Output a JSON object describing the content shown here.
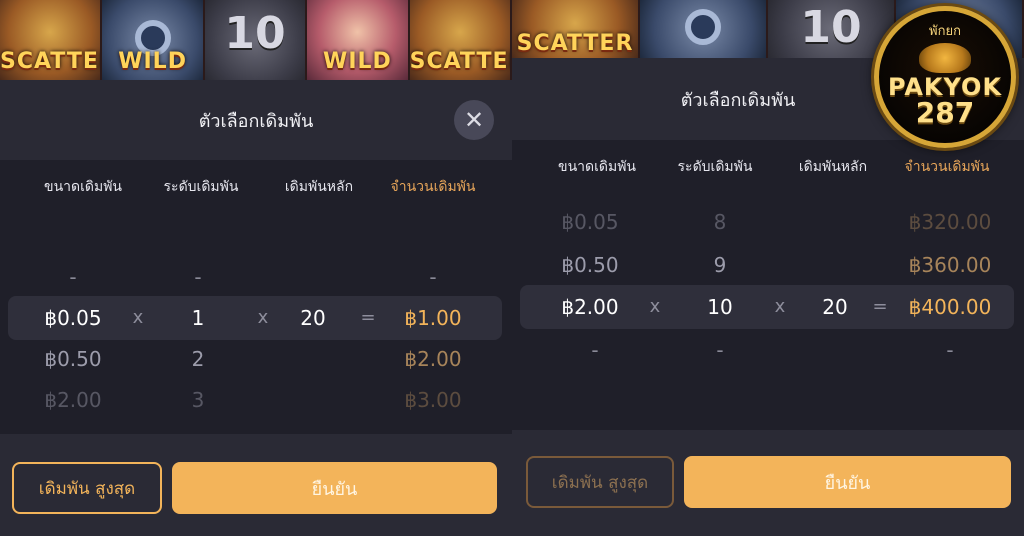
{
  "left": {
    "tiles": [
      {
        "kind": "scatter",
        "text": "SCATTER"
      },
      {
        "kind": "wild",
        "text": "WILD"
      },
      {
        "kind": "ten",
        "text": "10"
      },
      {
        "kind": "queen",
        "text": "WILD"
      },
      {
        "kind": "scatter",
        "text": "SCATTER"
      }
    ],
    "title": "ตัวเลือกเดิมพัน",
    "close_glyph": "✕",
    "columns": [
      "ขนาดเดิมพัน",
      "ระดับเดิมพัน",
      "เดิมพันหลัก",
      "จำนวนเดิมพัน"
    ],
    "rows": [
      {
        "size": "-",
        "level": "-",
        "amount": "-"
      },
      {
        "size": "฿0.05",
        "x1": "x",
        "level": "1",
        "x2": "x",
        "base": "20",
        "eq": "=",
        "amount": "฿1.00"
      },
      {
        "size": "฿0.50",
        "level": "2",
        "amount": "฿2.00"
      },
      {
        "size": "฿2.00",
        "level": "3",
        "amount": "฿3.00"
      }
    ],
    "max_bet_label": "เดิมพัน สูงสุด",
    "confirm_label": "ยืนยัน"
  },
  "right": {
    "tiles": [
      {
        "kind": "scatter",
        "text": "SCATTER"
      },
      {
        "kind": "wild",
        "text": ""
      },
      {
        "kind": "ten",
        "text": "10"
      },
      {
        "kind": "wild",
        "text": ""
      }
    ],
    "title": "ตัวเลือกเดิมพัน",
    "columns": [
      "ขนาดเดิมพัน",
      "ระดับเดิมพัน",
      "เดิมพันหลัก",
      "จำนวนเดิมพัน"
    ],
    "rows": [
      {
        "size": "฿0.05",
        "level": "8",
        "amount": "฿320.00"
      },
      {
        "size": "฿0.50",
        "level": "9",
        "amount": "฿360.00"
      },
      {
        "size": "฿2.00",
        "x1": "x",
        "level": "10",
        "x2": "x",
        "base": "20",
        "eq": "=",
        "amount": "฿400.00"
      },
      {
        "size": "-",
        "level": "-",
        "amount": "-"
      }
    ],
    "max_bet_label": "เดิมพัน สูงสุด",
    "confirm_label": "ยืนยัน"
  },
  "logo": {
    "top_text": "พักยก",
    "brand": "PAKYOK",
    "number": "287"
  },
  "colors": {
    "accent": "#f3b45a",
    "panel": "#2a2a35",
    "body": "#1f1f29"
  }
}
